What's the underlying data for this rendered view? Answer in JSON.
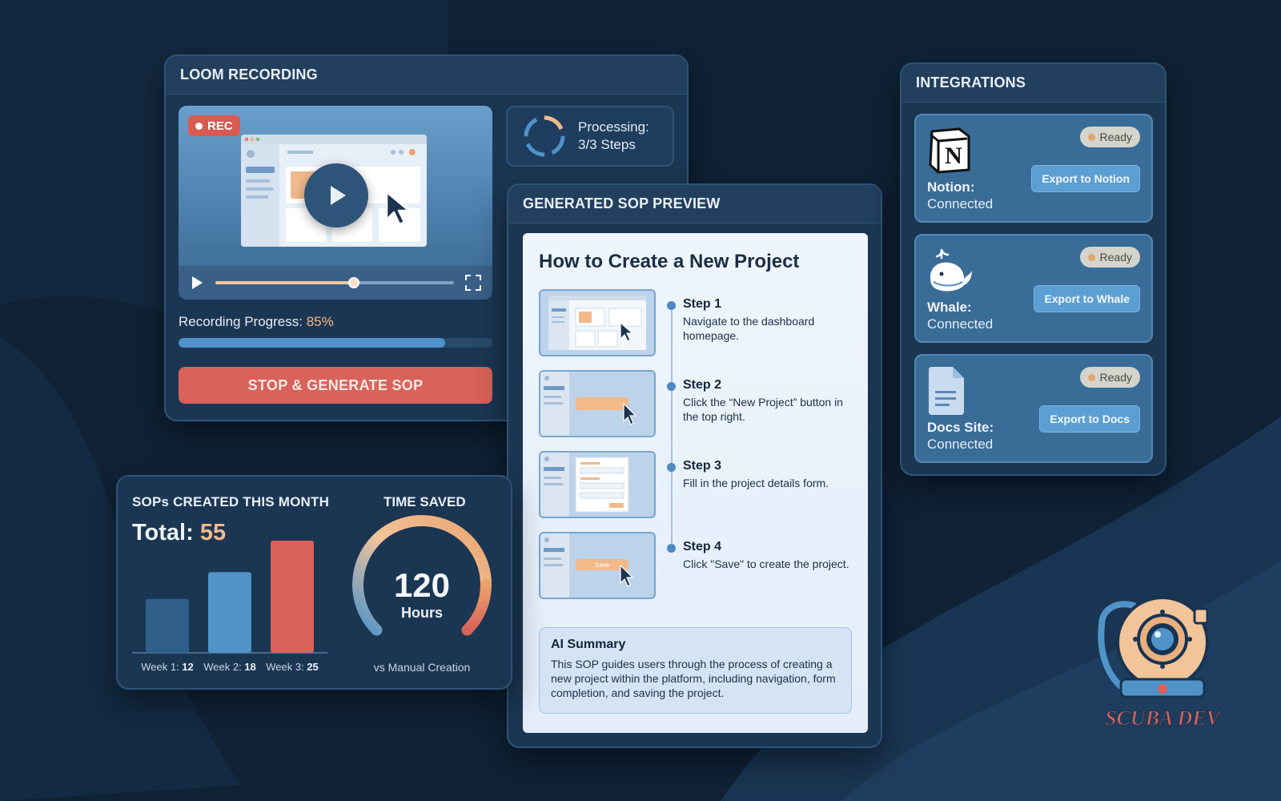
{
  "colors": {
    "background": "#0f2236",
    "panel": "#1b3653",
    "accent_orange": "#f2b98b",
    "accent_red": "#d9625a",
    "accent_blue": "#4f93c9"
  },
  "loom": {
    "header": "LOOM RECORDING",
    "rec_badge": "REC",
    "processing_line1": "Processing:",
    "processing_line2": "3/3 Steps",
    "seek_progress": 0.58,
    "progress_label": "Recording Progress:",
    "progress_value": "85%",
    "progress_fraction": 0.85,
    "stop_button": "STOP & GENERATE SOP",
    "icons": [
      "record-dot-icon",
      "play-icon",
      "fullscreen-icon",
      "spinner-icon",
      "cursor-icon"
    ]
  },
  "sop": {
    "header": "GENERATED SOP PREVIEW",
    "title": "How to Create a New Project",
    "steps": [
      {
        "title": "Step 1",
        "desc": "Navigate to the dashboard homepage."
      },
      {
        "title": "Step 2",
        "desc": "Click the “New Project” button in the top right."
      },
      {
        "title": "Step 3",
        "desc": "Fill in the project details form."
      },
      {
        "title": "Step 4",
        "desc": "Click \"Save\" to create the project."
      }
    ],
    "thumb_button_label": "Save",
    "ai_summary_title": "AI Summary",
    "ai_summary_text": "This SOP guides users through the process of creating a new project within the platform, including navigation, form completion, and saving the project."
  },
  "integrations": {
    "header": "INTEGRATIONS",
    "items": [
      {
        "name": "Notion:",
        "status": "Connected",
        "badge": "Ready",
        "button": "Export to Notion",
        "icon": "notion-icon"
      },
      {
        "name": "Whale:",
        "status": "Connected",
        "badge": "Ready",
        "button": "Export to Whale",
        "icon": "whale-icon"
      },
      {
        "name": "Docs Site:",
        "status": "Connected",
        "badge": "Ready",
        "button": "Export to Docs",
        "icon": "document-icon"
      }
    ]
  },
  "stats": {
    "left_title": "SOPs CREATED THIS MONTH",
    "total_label": "Total:",
    "total_value": "55",
    "right_title": "TIME SAVED",
    "gauge_value": "120",
    "gauge_unit": "Hours",
    "gauge_caption": "vs Manual Creation"
  },
  "chart_data": [
    {
      "type": "bar",
      "title": "SOPs CREATED THIS MONTH",
      "categories": [
        "Week 1:",
        "Week 2:",
        "Week 3:"
      ],
      "values": [
        12,
        18,
        25
      ],
      "value_labels": [
        "12",
        "18",
        "25"
      ],
      "colors": [
        "#2f5e88",
        "#4f93c9",
        "#d9625a"
      ],
      "ylim": [
        0,
        25
      ],
      "grid": false
    }
  ],
  "logo": {
    "text": "SCUBA DEV",
    "icon": "diving-helmet-icon"
  }
}
